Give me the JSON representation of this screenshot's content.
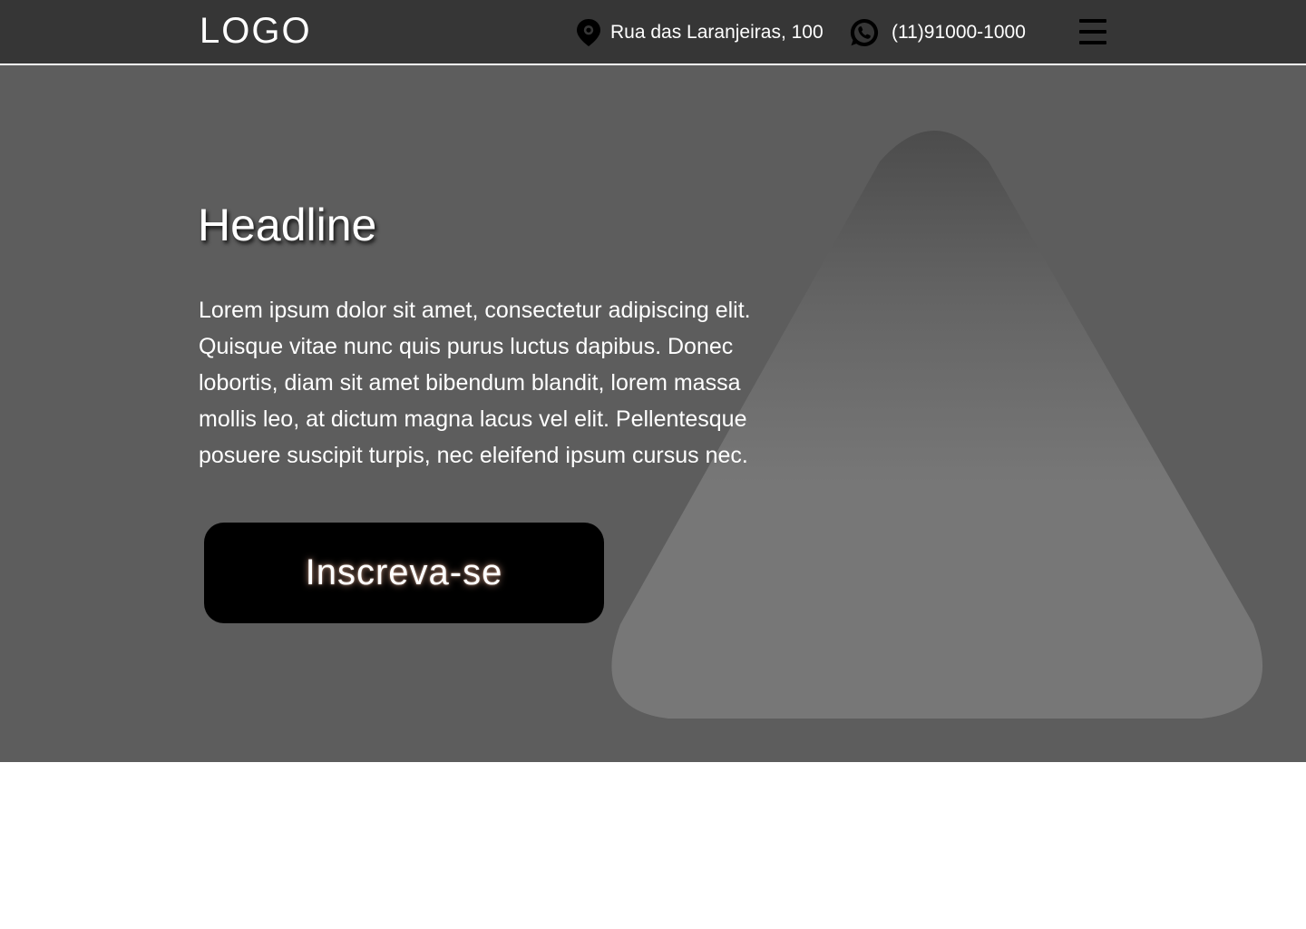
{
  "header": {
    "logo": "LOGO",
    "address": "Rua das Laranjeiras, 100",
    "phone": "(11)91000-1000",
    "icons": {
      "address": "map-pin-icon",
      "phone": "whatsapp-icon",
      "menu": "hamburger-menu-icon"
    }
  },
  "hero": {
    "headline": "Headline",
    "body": "Lorem ipsum dolor sit amet, consectetur adipiscing elit.  Quisque vitae nunc quis purus luctus dapibus. Donec lobortis, diam sit amet bibendum blandit, lorem massa mollis leo, at dictum magna lacus vel elit. Pellentesque posuere suscipit turpis, nec eleifend ipsum cursus nec.",
    "cta_label": "Inscreva-se"
  },
  "colors": {
    "header_background": "#363636",
    "hero_background": "#5d5d5d",
    "shape_fill": "#777777",
    "button_background": "#000000",
    "text": "#ffffff"
  }
}
